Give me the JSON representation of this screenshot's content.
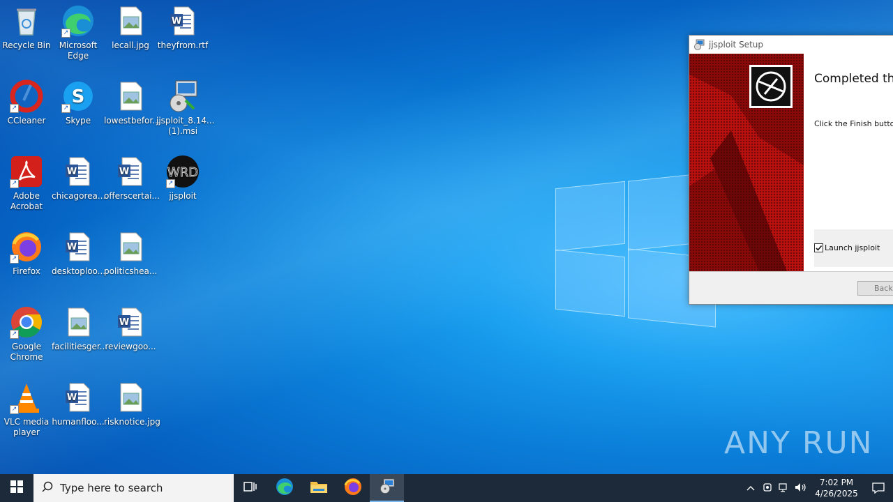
{
  "desktop": {
    "icons": [
      {
        "label": "Recycle Bin"
      },
      {
        "label": "Microsoft Edge"
      },
      {
        "label": "lecall.jpg"
      },
      {
        "label": "theyfrom.rtf"
      },
      {
        "label": "CCleaner"
      },
      {
        "label": "Skype"
      },
      {
        "label": "lowestbefor..."
      },
      {
        "label": "jjsploit_8.14...(1).msi"
      },
      {
        "label": "Adobe Acrobat"
      },
      {
        "label": "chicagorea..."
      },
      {
        "label": "offerscertai..."
      },
      {
        "label": "jjsploit"
      },
      {
        "label": "Firefox"
      },
      {
        "label": "desktoploo..."
      },
      {
        "label": "politicshea..."
      },
      {
        "label": "Google Chrome"
      },
      {
        "label": "facilitiesger..."
      },
      {
        "label": "reviewgoo..."
      },
      {
        "label": "VLC media player"
      },
      {
        "label": "humanfloo..."
      },
      {
        "label": "risknotice.jpg"
      }
    ]
  },
  "setup_window": {
    "title": "jjsploit Setup",
    "heading": "Completed the j",
    "body": "Click the Finish button t",
    "checkbox_label": "Launch jjsploit",
    "checkbox_checked": true,
    "back_button": "Back"
  },
  "taskbar": {
    "search_placeholder": "Type here to search",
    "time": "7:02 PM",
    "date": "4/26/2025"
  },
  "watermark": "ANY RUN"
}
